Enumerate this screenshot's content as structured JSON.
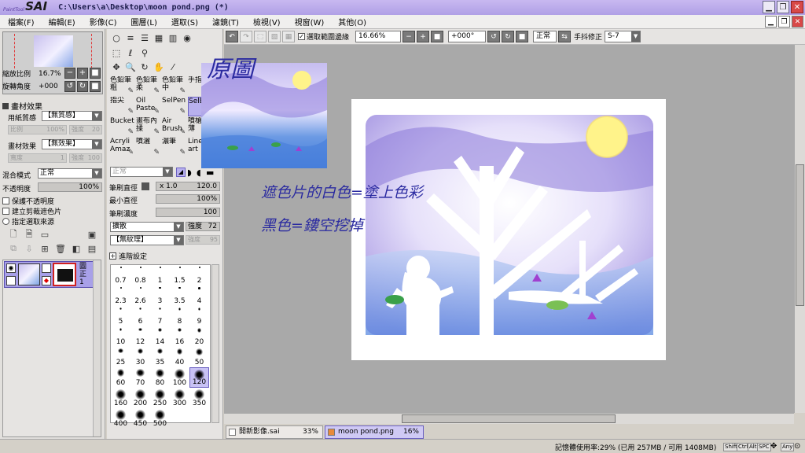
{
  "app": {
    "logo_small": "PaintTool",
    "logo_big": "SAI",
    "window_title": "C:\\Users\\a\\Desktop\\moon pond.png (*)"
  },
  "menu": [
    "檔案(F)",
    "編輯(E)",
    "影像(C)",
    "圖層(L)",
    "選取(S)",
    "濾鏡(T)",
    "檢視(V)",
    "視窗(W)",
    "其他(O)"
  ],
  "navigator": {
    "zoom_label": "縮放比例",
    "zoom_value": "16.7%",
    "rotation_label": "旋轉角度",
    "rotation_value": "+000"
  },
  "paper": {
    "section_title": "畫材效果",
    "paper_texture_label": "用紙質感",
    "paper_texture_value": "【無質感】",
    "scale_label": "比例",
    "scale_value": "100%",
    "strength_label": "強度",
    "strength_value": "20",
    "effect_label": "畫材效果",
    "effect_value": "【無效果】",
    "width_label": "寬度",
    "width_value": "1",
    "effect_strength_value": "100"
  },
  "layer_props": {
    "blend_label": "混合模式",
    "blend_value": "正常",
    "opacity_label": "不透明度",
    "opacity_value": "100%",
    "preserve_opacity": "保護不透明度",
    "clipping_group": "建立剪裁遮色片",
    "selection_source": "指定選取來源"
  },
  "layers": [
    {
      "name": "圖",
      "sub": "正",
      "extra": "1"
    }
  ],
  "tools": {
    "brushes": [
      {
        "label": "色鉛筆粗"
      },
      {
        "label": "色鉛筆柔"
      },
      {
        "label": "色鉛筆中"
      },
      {
        "label": "手指"
      },
      {
        "label": "指尖"
      },
      {
        "label": "Oil Paste"
      },
      {
        "label": "SelPen"
      },
      {
        "label": "SelE"
      },
      {
        "label": "Bucket"
      },
      {
        "label": "畫布內揉"
      },
      {
        "label": "Air Brush"
      },
      {
        "label": "噴槍輕薄"
      },
      {
        "label": "Acryli Amaz"
      },
      {
        "label": "噴灑"
      },
      {
        "label": "濃筆"
      },
      {
        "label": "Line art"
      }
    ],
    "mode_value": "正常",
    "brush_size_label": "筆刷直徑",
    "brush_size_mult": "x 1.0",
    "brush_size_value": "120.0",
    "min_size_label": "最小直徑",
    "min_size_value": "100%",
    "density_label": "筆刷濃度",
    "density_value": "100",
    "shape_value": "擴散",
    "shape_strength_label": "強度",
    "shape_strength_value": "72",
    "texture_value": "【無紋理】",
    "texture_strength_label": "強度",
    "texture_strength_value": "95",
    "advanced_label": "進階設定",
    "sizes": [
      "0.7",
      "0.8",
      "1",
      "1.5",
      "2",
      "2.3",
      "2.6",
      "3",
      "3.5",
      "4",
      "5",
      "6",
      "7",
      "8",
      "9",
      "10",
      "12",
      "14",
      "16",
      "20",
      "25",
      "30",
      "35",
      "40",
      "50",
      "60",
      "70",
      "80",
      "100",
      "120",
      "160",
      "200",
      "250",
      "300",
      "350",
      "400",
      "450",
      "500"
    ],
    "selected_size": "120"
  },
  "toolbar": {
    "antialias_label": "選取範圍邊緣",
    "zoom_value": "16.66%",
    "rotation_value": "+000°",
    "blend_value": "正常",
    "stabilizer_label": "手抖修正",
    "stabilizer_value": "S-7"
  },
  "canvas": {
    "overlay_title": "原圖",
    "caption_line1": "遮色片的白色=塗上色彩",
    "caption_line2": "黑色=鏤空挖掉"
  },
  "tabs": [
    {
      "name": "開新影像.sai",
      "pct": "33%",
      "active": false
    },
    {
      "name": "moon pond.png",
      "pct": "16%",
      "active": true
    }
  ],
  "status": {
    "memory": "記憶體使用率:29% (已用 257MB / 可用 1408MB)",
    "keys": [
      "Shift",
      "Ctrl",
      "Alt",
      "SPC",
      "Any"
    ]
  },
  "colors": {
    "title_bar": "#b8a8ea",
    "selection": "#b8b0ee",
    "caption_text": "#2a2aa0",
    "canvas_bg": "#a9a9a9"
  }
}
